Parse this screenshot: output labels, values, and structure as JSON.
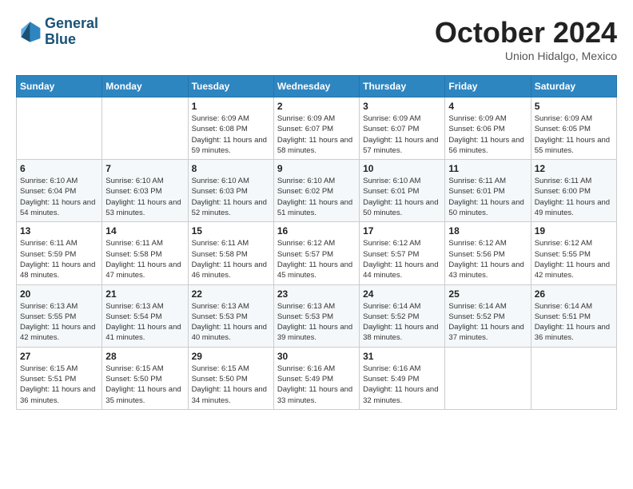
{
  "header": {
    "logo": {
      "line1": "General",
      "line2": "Blue"
    },
    "title": "October 2024",
    "subtitle": "Union Hidalgo, Mexico"
  },
  "weekdays": [
    "Sunday",
    "Monday",
    "Tuesday",
    "Wednesday",
    "Thursday",
    "Friday",
    "Saturday"
  ],
  "weeks": [
    [
      {
        "day": "",
        "info": ""
      },
      {
        "day": "",
        "info": ""
      },
      {
        "day": "1",
        "info": "Sunrise: 6:09 AM\nSunset: 6:08 PM\nDaylight: 11 hours and 59 minutes."
      },
      {
        "day": "2",
        "info": "Sunrise: 6:09 AM\nSunset: 6:07 PM\nDaylight: 11 hours and 58 minutes."
      },
      {
        "day": "3",
        "info": "Sunrise: 6:09 AM\nSunset: 6:07 PM\nDaylight: 11 hours and 57 minutes."
      },
      {
        "day": "4",
        "info": "Sunrise: 6:09 AM\nSunset: 6:06 PM\nDaylight: 11 hours and 56 minutes."
      },
      {
        "day": "5",
        "info": "Sunrise: 6:09 AM\nSunset: 6:05 PM\nDaylight: 11 hours and 55 minutes."
      }
    ],
    [
      {
        "day": "6",
        "info": "Sunrise: 6:10 AM\nSunset: 6:04 PM\nDaylight: 11 hours and 54 minutes."
      },
      {
        "day": "7",
        "info": "Sunrise: 6:10 AM\nSunset: 6:03 PM\nDaylight: 11 hours and 53 minutes."
      },
      {
        "day": "8",
        "info": "Sunrise: 6:10 AM\nSunset: 6:03 PM\nDaylight: 11 hours and 52 minutes."
      },
      {
        "day": "9",
        "info": "Sunrise: 6:10 AM\nSunset: 6:02 PM\nDaylight: 11 hours and 51 minutes."
      },
      {
        "day": "10",
        "info": "Sunrise: 6:10 AM\nSunset: 6:01 PM\nDaylight: 11 hours and 50 minutes."
      },
      {
        "day": "11",
        "info": "Sunrise: 6:11 AM\nSunset: 6:01 PM\nDaylight: 11 hours and 50 minutes."
      },
      {
        "day": "12",
        "info": "Sunrise: 6:11 AM\nSunset: 6:00 PM\nDaylight: 11 hours and 49 minutes."
      }
    ],
    [
      {
        "day": "13",
        "info": "Sunrise: 6:11 AM\nSunset: 5:59 PM\nDaylight: 11 hours and 48 minutes."
      },
      {
        "day": "14",
        "info": "Sunrise: 6:11 AM\nSunset: 5:58 PM\nDaylight: 11 hours and 47 minutes."
      },
      {
        "day": "15",
        "info": "Sunrise: 6:11 AM\nSunset: 5:58 PM\nDaylight: 11 hours and 46 minutes."
      },
      {
        "day": "16",
        "info": "Sunrise: 6:12 AM\nSunset: 5:57 PM\nDaylight: 11 hours and 45 minutes."
      },
      {
        "day": "17",
        "info": "Sunrise: 6:12 AM\nSunset: 5:57 PM\nDaylight: 11 hours and 44 minutes."
      },
      {
        "day": "18",
        "info": "Sunrise: 6:12 AM\nSunset: 5:56 PM\nDaylight: 11 hours and 43 minutes."
      },
      {
        "day": "19",
        "info": "Sunrise: 6:12 AM\nSunset: 5:55 PM\nDaylight: 11 hours and 42 minutes."
      }
    ],
    [
      {
        "day": "20",
        "info": "Sunrise: 6:13 AM\nSunset: 5:55 PM\nDaylight: 11 hours and 42 minutes."
      },
      {
        "day": "21",
        "info": "Sunrise: 6:13 AM\nSunset: 5:54 PM\nDaylight: 11 hours and 41 minutes."
      },
      {
        "day": "22",
        "info": "Sunrise: 6:13 AM\nSunset: 5:53 PM\nDaylight: 11 hours and 40 minutes."
      },
      {
        "day": "23",
        "info": "Sunrise: 6:13 AM\nSunset: 5:53 PM\nDaylight: 11 hours and 39 minutes."
      },
      {
        "day": "24",
        "info": "Sunrise: 6:14 AM\nSunset: 5:52 PM\nDaylight: 11 hours and 38 minutes."
      },
      {
        "day": "25",
        "info": "Sunrise: 6:14 AM\nSunset: 5:52 PM\nDaylight: 11 hours and 37 minutes."
      },
      {
        "day": "26",
        "info": "Sunrise: 6:14 AM\nSunset: 5:51 PM\nDaylight: 11 hours and 36 minutes."
      }
    ],
    [
      {
        "day": "27",
        "info": "Sunrise: 6:15 AM\nSunset: 5:51 PM\nDaylight: 11 hours and 36 minutes."
      },
      {
        "day": "28",
        "info": "Sunrise: 6:15 AM\nSunset: 5:50 PM\nDaylight: 11 hours and 35 minutes."
      },
      {
        "day": "29",
        "info": "Sunrise: 6:15 AM\nSunset: 5:50 PM\nDaylight: 11 hours and 34 minutes."
      },
      {
        "day": "30",
        "info": "Sunrise: 6:16 AM\nSunset: 5:49 PM\nDaylight: 11 hours and 33 minutes."
      },
      {
        "day": "31",
        "info": "Sunrise: 6:16 AM\nSunset: 5:49 PM\nDaylight: 11 hours and 32 minutes."
      },
      {
        "day": "",
        "info": ""
      },
      {
        "day": "",
        "info": ""
      }
    ]
  ]
}
